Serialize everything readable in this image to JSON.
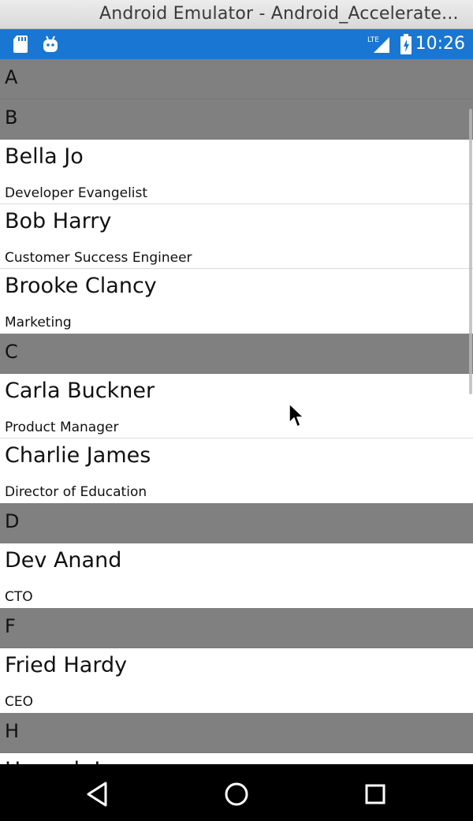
{
  "window": {
    "title": "Android Emulator - Android_Accelerate..."
  },
  "status_bar": {
    "time": "10:26",
    "network": "LTE"
  },
  "contacts": {
    "groups": [
      {
        "letter": "A",
        "items": []
      },
      {
        "letter": "B",
        "items": [
          {
            "name": "Bella Jo",
            "role": "Developer Evangelist"
          },
          {
            "name": "Bob Harry",
            "role": "Customer Success Engineer"
          },
          {
            "name": "Brooke Clancy",
            "role": "Marketing"
          }
        ]
      },
      {
        "letter": "C",
        "items": [
          {
            "name": "Carla Buckner",
            "role": "Product Manager"
          },
          {
            "name": "Charlie James",
            "role": "Director of Education"
          }
        ]
      },
      {
        "letter": "D",
        "items": [
          {
            "name": "Dev Anand",
            "role": "CTO"
          }
        ]
      },
      {
        "letter": "F",
        "items": [
          {
            "name": "Fried Hardy",
            "role": "CEO"
          }
        ]
      },
      {
        "letter": "H",
        "items": [
          {
            "name": "Hannah Icaza",
            "role": ""
          }
        ]
      }
    ]
  },
  "icons": {
    "status_left": [
      "sd-card-icon",
      "android-icon"
    ],
    "status_right": [
      "lte-signal-icon",
      "battery-icon"
    ],
    "nav": [
      "back-icon",
      "home-icon",
      "recents-icon"
    ]
  },
  "colors": {
    "status_bar": "#1976d2",
    "section_header": "#808080",
    "nav_bar": "#000000"
  }
}
